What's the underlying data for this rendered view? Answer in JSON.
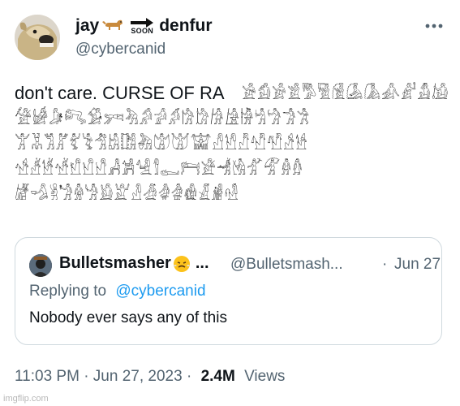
{
  "tweet": {
    "display_name_start": "jay",
    "display_name_end": "denfur",
    "soon_emoji_text": "SOON",
    "handle": "@cybercanid",
    "text": "don't care. CURSE OF RA",
    "glyph_lines": [
      "𓀀𓀁𓀂𓀃𓀄𓀅𓀆𓀇𓀈𓀉𓀊𓀋𓀌",
      "𓀍𓀎𓀏𓀐𓀑𓀒𓀓𓀔𓀕𓀖𓀗𓀘𓀙𓀚𓀛𓀜𓀝𓀞𓀟",
      "𓀠𓀡𓀢𓀣𓀤𓀥𓀦𓀧𓀨𓀩𓀪𓀫𓀬𓀭𓀮𓀯𓀰𓀱𓀲𓀳",
      "𓀴𓀵𓀶𓀷𓀸𓀹𓀺𓀻𓀼𓀽𓀾𓀿𓁀𓁁𓁂𓁃𓁄𓁅𓁆𓁇",
      "𓁈𓁉𓁊𓁋𓁌𓁍𓁎𓁏𓁐𓁑𓁒𓁓𓁔𓁕𓁖𓁗"
    ],
    "timestamp": "11:03 PM · Jun 27, 2023 ·",
    "views_count": "2.4M",
    "views_label": "Views"
  },
  "quote": {
    "display_name": "Bulletsmasher",
    "ellipsis": "...",
    "handle": "@Bulletsmash...",
    "dot": "·",
    "date": "Jun 27",
    "replying_prefix": "Replying to",
    "replying_handle": "@cybercanid",
    "text": "Nobody ever says any of this"
  },
  "watermark": "imgflip.com",
  "colors": {
    "text": "#0f1419",
    "secondary": "#536471",
    "link": "#1d9bf0",
    "border": "#cfd9de"
  },
  "icons": [
    "dog-emoji",
    "soon-arrow-emoji",
    "more-icon",
    "steaming-face-emoji"
  ]
}
